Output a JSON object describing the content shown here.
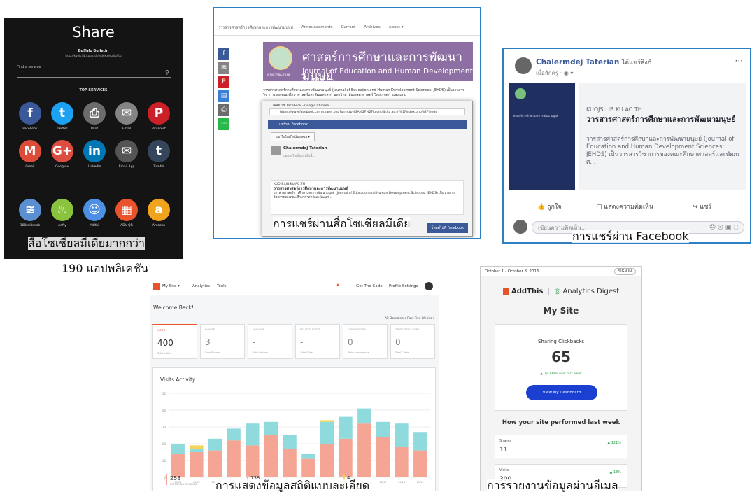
{
  "share_panel": {
    "title": "Share",
    "site_name": "Buffalo Bulletin",
    "site_url": "http://kuojs.lib.ku.ac.th/index.php/lib/ftu",
    "find_label": "Find a service",
    "top_services_label": "TOP SERVICES",
    "services": [
      {
        "label": "Facebook",
        "glyph": "f",
        "color": "#3b5998",
        "icon": "facebook-icon"
      },
      {
        "label": "Twitter",
        "glyph": "t",
        "color": "#1da1f2",
        "icon": "twitter-icon"
      },
      {
        "label": "Print",
        "glyph": "⎙",
        "color": "#6c6c6c",
        "icon": "print-icon"
      },
      {
        "label": "Email",
        "glyph": "✉",
        "color": "#848484",
        "icon": "email-icon"
      },
      {
        "label": "Pinterest",
        "glyph": "P",
        "color": "#cb2027",
        "icon": "pinterest-icon"
      },
      {
        "label": "Gmail",
        "glyph": "M",
        "color": "#dd4b39",
        "icon": "gmail-icon"
      },
      {
        "label": "Google+",
        "glyph": "G+",
        "color": "#dc4e41",
        "icon": "google-plus-icon"
      },
      {
        "label": "LinkedIn",
        "glyph": "in",
        "color": "#0077b5",
        "icon": "linkedin-icon"
      },
      {
        "label": "Email App",
        "glyph": "✉",
        "color": "#555555",
        "icon": "email-app-icon"
      },
      {
        "label": "Tumblr",
        "glyph": "t",
        "color": "#35465c",
        "icon": "tumblr-icon"
      },
      {
        "label": "100zakladok",
        "glyph": "≋",
        "color": "#5b8fd1",
        "icon": "zakladok-icon"
      },
      {
        "label": "Adfty",
        "glyph": "♨",
        "color": "#8ac43f",
        "icon": "adfty-icon"
      },
      {
        "label": "Adifni",
        "glyph": "☺",
        "color": "#4b90e2",
        "icon": "adifni-icon"
      },
      {
        "label": "ADV QR",
        "glyph": "▦",
        "color": "#e8532c",
        "icon": "adv-qr-icon"
      },
      {
        "label": "Amazon",
        "glyph": "a",
        "color": "#f0a31c",
        "icon": "amazon-icon"
      }
    ],
    "caption_line1": "สื่อโซเชียลมีเดียมากกว่า",
    "caption_line2": "190 แอปพลิเคชัน"
  },
  "journal_panel": {
    "nav": [
      "วารสารศาสตร์การศึกษาและการพัฒนามนุษย์",
      "Announcements",
      "Current",
      "Archives",
      "About ▾"
    ],
    "banner_th": "ศาสตร์การศึกษาและการพัฒนามนุษย์",
    "banner_en": "Journal of Education and Human Development Sciences",
    "issn": "ISSN 2586-7248",
    "body_text": "วารสารศาสตร์การศึกษาและการพัฒนามนุษย์ (Journal of Education and Human Development Sciences: JEHDS) เป็นวารสารวิชาการของคณะศึกษาศาสตร์และพัฒนศาสตร์ มหาวิทยาลัยเกษตรศาสตร์ วิทยาเขตกำแพงแสน",
    "popup": {
      "chrome_title": "โพสต์ไปที่ Facebook - Google Chrome",
      "address": "https://www.facebook.com/sharer.php?u=http%3A%2F%2Fkuojs.lib.ku.ac.th%2Findex.php%2Fjehds",
      "header": "แชร์บน Facebook",
      "select": "แชร์ในไทม์ไลน์ของคุณ ▾",
      "user": "Chalermdej Taterian",
      "placeholder": "บอกอะไรเกี่ยวกับสิ่งนี้...",
      "card_domain": "KUOJS.LIB.KU.AC.TH",
      "card_title": "วารสารศาสตร์การศึกษาและการพัฒนามนุษย์",
      "card_text": "วารสารศาสตร์การศึกษาและการพัฒนามนุษย์ (Journal of Education and Human Development Sciences: JEHDS) เป็นวารสารวิชาการของคณะศึกษาศาสตร์และพัฒนศ...",
      "post_button": "โพสต์ไปที่ Facebook"
    },
    "caption": "การแชร์ผ่านสื่อโซเชียลมีเดีย"
  },
  "facebook_panel": {
    "user": "Chalermdej Taterian",
    "action": "ได้แชร์ลิงก์",
    "when": "เมื่อสักครู่ · ◉ ▾",
    "domain": "KUOJS.LIB.KU.AC.TH",
    "headline": "วารสารศาสตร์การศึกษาและการพัฒนามนุษย์",
    "summary": "วารสารศาสตร์การศึกษาและการพัฒนามนุษย์ (Journal of Education and Human Development Sciences: JEHDS) เป็นวารสารวิชาการของคณะศึกษาศาสตร์และพัฒนศ...",
    "like": "ถูกใจ",
    "comment": "แสดงความคิดเห็น",
    "share": "แชร์",
    "comment_placeholder": "เขียนความคิดเห็น...",
    "caption": "การแชร์ผ่าน Facebook"
  },
  "analytics_panel": {
    "nav": {
      "site": "My Site ▾",
      "analytics": "Analytics",
      "tools": "Tools",
      "get_code": "Get The Code",
      "profile": "Profile Settings"
    },
    "welcome": "Welcome Back!",
    "filters": "All Domains ▾      Past Two Weeks ▾",
    "stats": [
      {
        "label": "VISITS",
        "value": "400",
        "sub": "Total Visits"
      },
      {
        "label": "SHARES",
        "value": "3",
        "sub": "Total Shares"
      },
      {
        "label": "FOLLOWS",
        "value": "-",
        "sub": "Total Follows"
      },
      {
        "label": "RELATED POSTS",
        "value": "-",
        "sub": "Total Clicks"
      },
      {
        "label": "CONVERSIONS",
        "value": "0",
        "sub": "Total Conversions"
      },
      {
        "label": "TIP BUTTON CLICKS",
        "value": "0",
        "sub": "Total Clicks"
      }
    ],
    "chart_title": "Visits Activity",
    "footer_values": [
      "258",
      "138",
      "4"
    ],
    "footer_label": "REFERRING DOMAINS",
    "caption": "การแสดงข้อมูลสถิติแบบละเอียด"
  },
  "chart_data": {
    "type": "bar",
    "title": "Visits Activity",
    "ylim": [
      0,
      50
    ],
    "yticks": [
      0,
      10,
      20,
      30,
      40,
      50
    ],
    "categories": [
      "10/06",
      "10/07",
      "10/08",
      "10/09",
      "10/10",
      "10/11",
      "10/12",
      "10/13",
      "10/14",
      "10/15",
      "10/16",
      "10/17",
      "10/18",
      "10/19"
    ],
    "series": [
      {
        "name": "",
        "color": "#f4a593",
        "values": [
          14,
          15,
          16,
          22,
          19,
          25,
          17,
          11,
          20,
          23,
          32,
          24,
          18,
          16
        ]
      },
      {
        "name": "",
        "color": "#8fdadd",
        "values": [
          6,
          2,
          7,
          7,
          13,
          8,
          8,
          3,
          13,
          13,
          9,
          9,
          14,
          11
        ]
      },
      {
        "name": "",
        "color": "#f6d35b",
        "values": [
          0,
          2,
          0,
          0,
          0,
          0,
          0,
          0,
          1,
          0,
          0,
          0,
          0,
          0
        ]
      }
    ],
    "grid": true
  },
  "email_panel": {
    "date_range": "October 1 - October 8, 2016",
    "sign_in": "SIGN IN",
    "brand_addthis": "AddThis",
    "brand_digest": "Analytics Digest",
    "my_site": "My Site",
    "metric_label": "Sharing Clickbacks",
    "metric_value": "65",
    "metric_change": "▲ Up 334% over last week",
    "button": "View My Dashboard",
    "performed": "How your site performed last week",
    "rows": [
      {
        "label": "Shares",
        "value": "11",
        "change": "▲ 121%"
      },
      {
        "label": "Visits",
        "value": "300",
        "change": "▲ 13%"
      }
    ],
    "caption": "การรายงานข้อมูลผ่านอีเมล"
  }
}
